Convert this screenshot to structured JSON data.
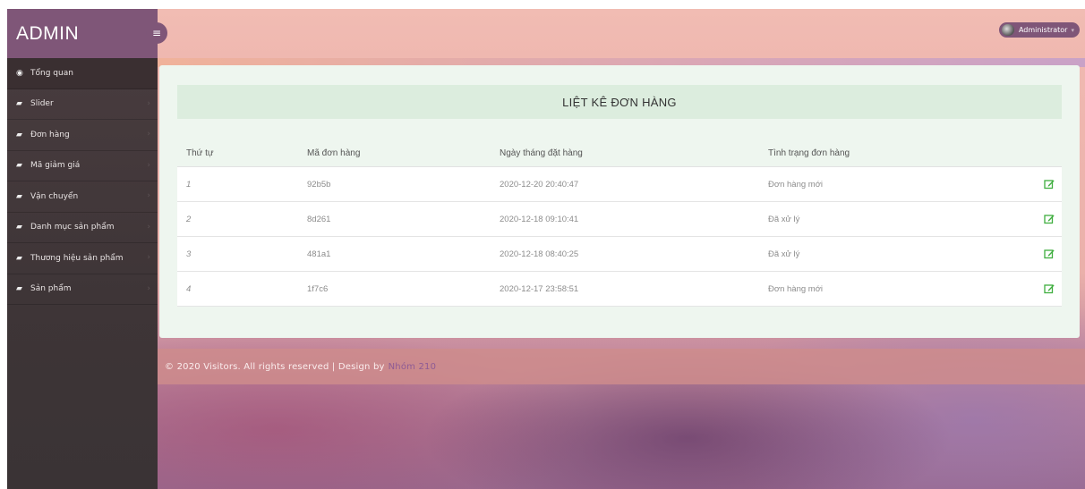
{
  "brand": {
    "title": "ADMIN"
  },
  "header": {
    "user_name": "Administrator"
  },
  "sidebar": {
    "items": [
      {
        "label": "Tổng quan",
        "icon": "dashboard-icon"
      },
      {
        "label": "Slider",
        "icon": "book-icon"
      },
      {
        "label": "Đơn hàng",
        "icon": "book-icon"
      },
      {
        "label": "Mã giảm giá",
        "icon": "book-icon"
      },
      {
        "label": "Vận chuyển",
        "icon": "book-icon"
      },
      {
        "label": "Danh mục sản phẩm",
        "icon": "book-icon"
      },
      {
        "label": "Thương hiệu sản phẩm",
        "icon": "book-icon"
      },
      {
        "label": "Sản phẩm",
        "icon": "book-icon"
      }
    ]
  },
  "main": {
    "title": "LIỆT KÊ ĐƠN HÀNG",
    "columns": [
      "Thứ tự",
      "Mã đơn hàng",
      "Ngày tháng đặt hàng",
      "Tình trạng đơn hàng"
    ],
    "rows": [
      {
        "index": "1",
        "code": "92b5b",
        "date": "2020-12-20 20:40:47",
        "status": "Đơn hàng mới"
      },
      {
        "index": "2",
        "code": "8d261",
        "date": "2020-12-18 09:10:41",
        "status": "Đã xử lý"
      },
      {
        "index": "3",
        "code": "481a1",
        "date": "2020-12-18 08:40:25",
        "status": "Đã xử lý"
      },
      {
        "index": "4",
        "code": "1f7c6",
        "date": "2020-12-17 23:58:51",
        "status": "Đơn hàng mới"
      }
    ]
  },
  "footer": {
    "text": "© 2020 Visitors. All rights reserved | Design by",
    "link": "Nhóm 210"
  },
  "colors": {
    "brand": "#7f5678",
    "sidebar": "#3e3537",
    "header": "#efb8b0",
    "panel": "#eef6ef",
    "edit_icon": "#3fae3f"
  }
}
